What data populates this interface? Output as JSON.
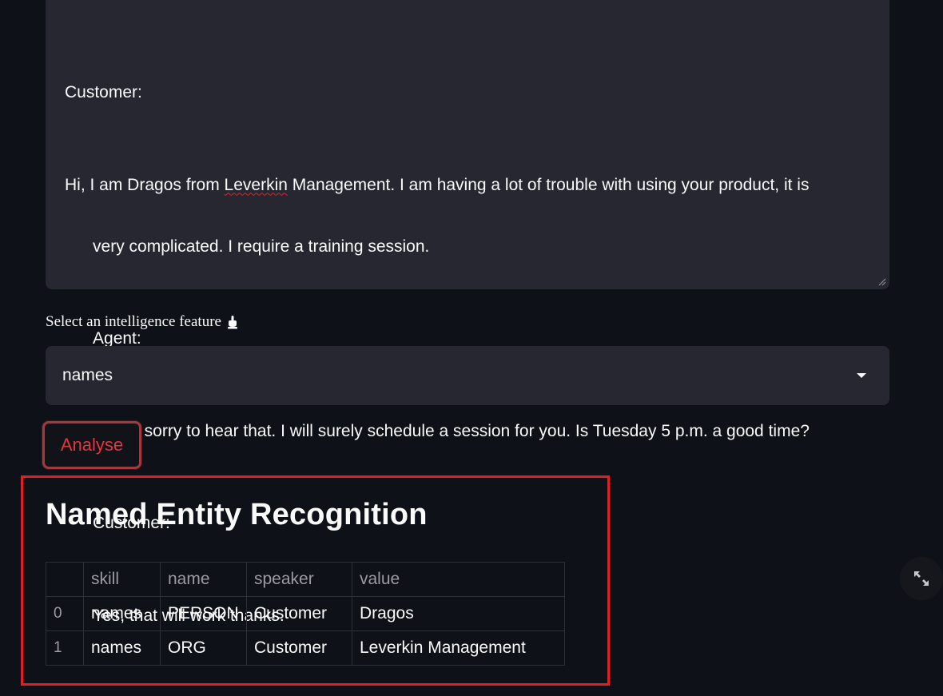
{
  "transcript": {
    "lines": [
      {
        "pre": "Customer:"
      },
      {
        "pre": "Hi, I am Dragos from ",
        "flagged": "Leverkin",
        "post": " Management. I am having a lot of trouble with using your product, it is"
      },
      {
        "pre": "very complicated. I require a training session."
      },
      {
        "pre": "Agent:"
      },
      {
        "pre": "Hi, I'm sorry to hear that. I will surely schedule a session for you. Is Tuesday 5 p.m. a good time?"
      },
      {
        "pre": "Customer:"
      },
      {
        "pre": "Yes, that will work thanks."
      }
    ]
  },
  "feature_select": {
    "label": "Select an intelligence feature",
    "label_icon": "pointing-down-hand-icon",
    "value": "names"
  },
  "analyse_button": {
    "label": "Analyse"
  },
  "results": {
    "title": "Named Entity Recognition",
    "columns": [
      "",
      "skill",
      "name",
      "speaker",
      "value"
    ],
    "rows": [
      {
        "index": "0",
        "skill": "names",
        "name": "PERSON",
        "speaker": "Customer",
        "value": "Dragos"
      },
      {
        "index": "1",
        "skill": "names",
        "name": "ORG",
        "speaker": "Customer",
        "value": "Leverkin Management"
      }
    ]
  },
  "fullscreen_icon": "expand-arrows-icon",
  "colors": {
    "background": "#0e1117",
    "input_background": "#262730",
    "accent_red": "#e0363f",
    "highlight_border": "#e01e26"
  }
}
